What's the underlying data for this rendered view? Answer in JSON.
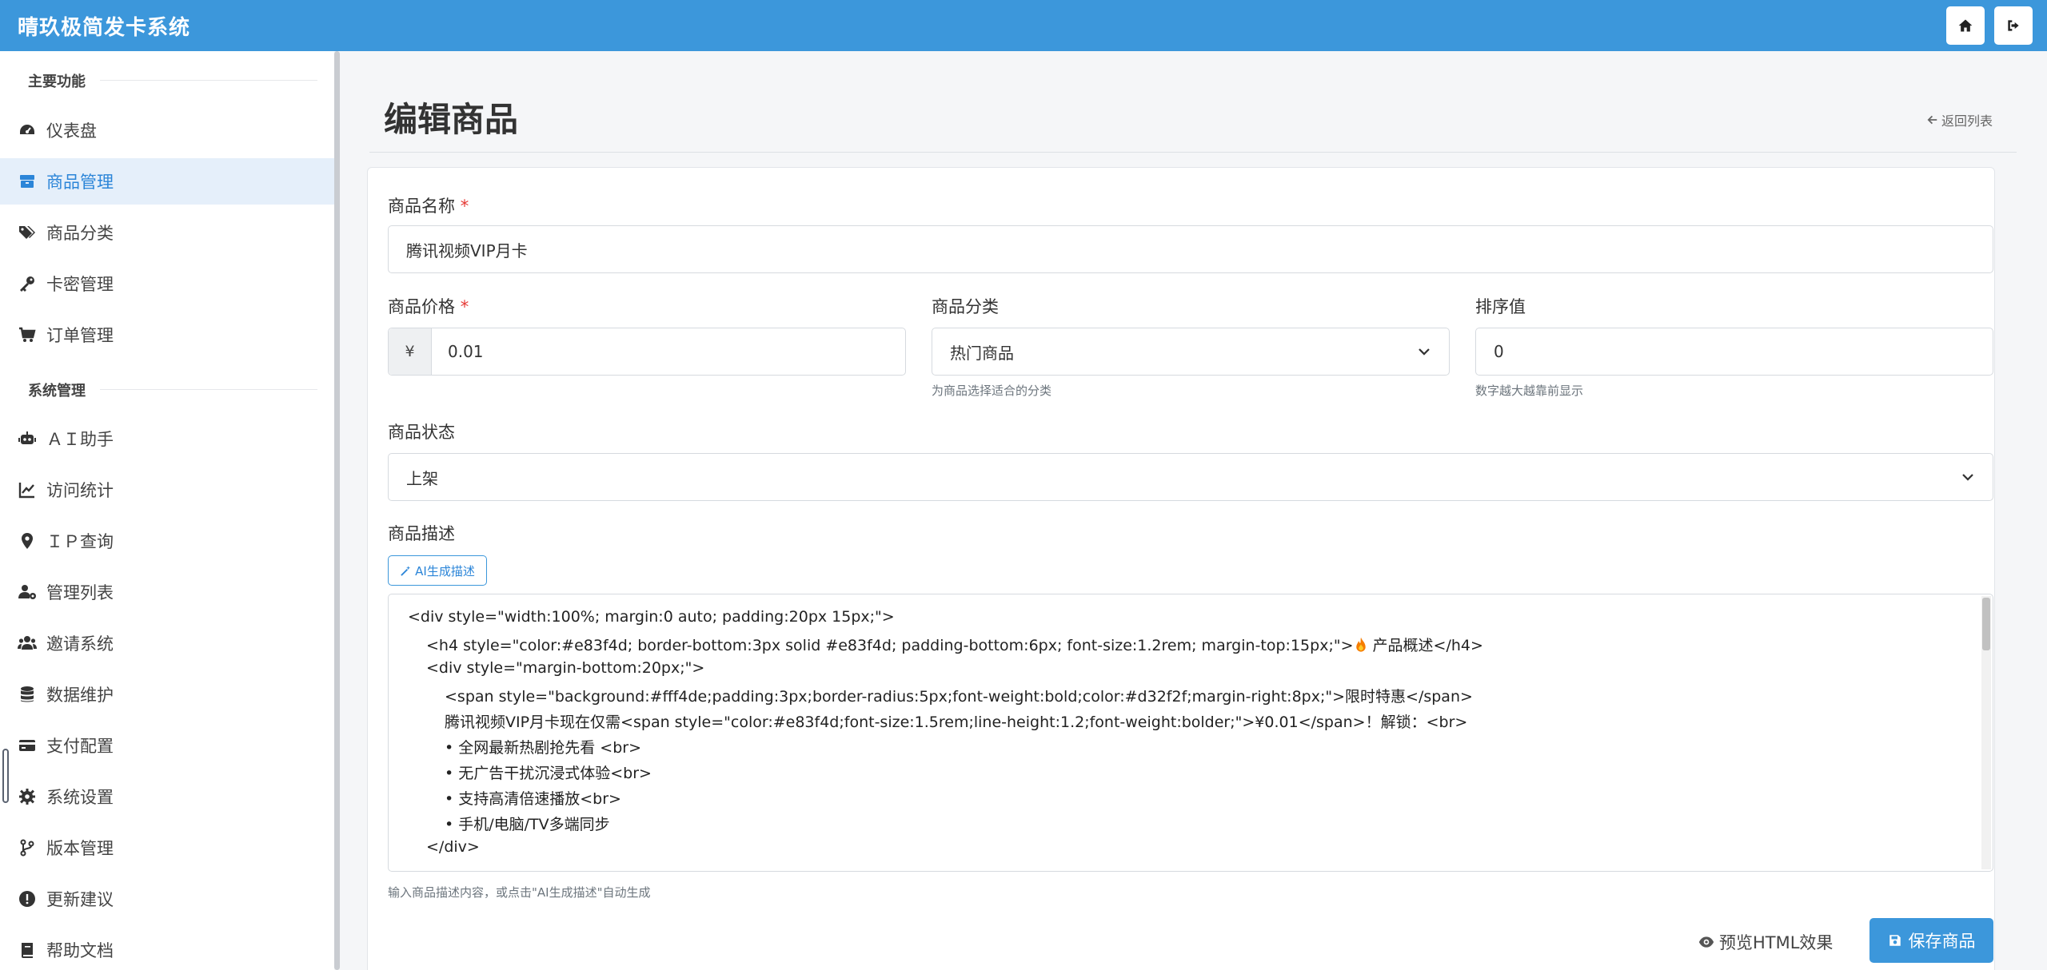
{
  "app": {
    "title": "晴玖极简发卡系统"
  },
  "sidebar": {
    "sections": [
      {
        "title": "主要功能"
      },
      {
        "title": "系统管理"
      }
    ],
    "items": [
      {
        "label": "仪表盘",
        "icon": "gauge-icon"
      },
      {
        "label": "商品管理",
        "icon": "box-icon",
        "active": true
      },
      {
        "label": "商品分类",
        "icon": "tags-icon"
      },
      {
        "label": "卡密管理",
        "icon": "key-icon"
      },
      {
        "label": "订单管理",
        "icon": "cart-icon"
      },
      {
        "label": "ＡＩ助手",
        "icon": "robot-icon"
      },
      {
        "label": "访问统计",
        "icon": "chart-line-icon"
      },
      {
        "label": "ＩＰ查询",
        "icon": "map-pin-icon"
      },
      {
        "label": "管理列表",
        "icon": "users-cog-icon"
      },
      {
        "label": "邀请系统",
        "icon": "users-icon"
      },
      {
        "label": "数据维护",
        "icon": "database-icon"
      },
      {
        "label": "支付配置",
        "icon": "credit-card-icon"
      },
      {
        "label": "系统设置",
        "icon": "gear-icon"
      },
      {
        "label": "版本管理",
        "icon": "code-branch-icon"
      },
      {
        "label": "更新建议",
        "icon": "exclamation-circle-icon"
      },
      {
        "label": "帮助文档",
        "icon": "book-icon"
      }
    ]
  },
  "page": {
    "title": "编辑商品",
    "back_label": "返回列表"
  },
  "form": {
    "name_label": "商品名称",
    "required_mark": "*",
    "name_value": "腾讯视频VIP月卡",
    "price_label": "商品价格",
    "price_prefix": "¥",
    "price_value": "0.01",
    "category_label": "商品分类",
    "category_value": "热门商品",
    "category_hint": "为商品选择适合的分类",
    "sort_label": "排序值",
    "sort_value": "0",
    "sort_hint": "数字越大越靠前显示",
    "status_label": "商品状态",
    "status_value": "上架",
    "desc_label": "商品描述",
    "ai_button": "AI生成描述",
    "desc_lines": [
      "<div style=\"width:100%; margin:0 auto; padding:20px 15px;\">",
      "<h4 style=\"color:#e83f4d; border-bottom:3px solid #e83f4d; padding-bottom:6px; font-size:1.2rem; margin-top:15px;\">",
      " 产品概述</h4>",
      "<div style=\"margin-bottom:20px;\">",
      "<span style=\"background:#fff4de;padding:3px;border-radius:5px;font-weight:bold;color:#d32f2f;margin-right:8px;\">限时特惠</span>",
      "腾讯视频VIP月卡现在仅需<span style=\"color:#e83f4d;font-size:1.5rem;line-height:1.2;font-weight:bolder;\">¥0.01</span>！解锁：<br>",
      "• 全网最新热剧抢先看 <br>",
      "• 无广告干扰沉浸式体验<br>",
      "• 支持高清倍速播放<br>",
      "• 手机/电脑/TV多端同步",
      "</div>"
    ],
    "desc_hint": "输入商品描述内容，或点击\"AI生成描述\"自动生成",
    "preview_button": "预览HTML效果",
    "save_button": "保存商品"
  },
  "colors": {
    "brand": "#3c97db",
    "accent_text": "#2b85d8",
    "required": "#e53935"
  }
}
